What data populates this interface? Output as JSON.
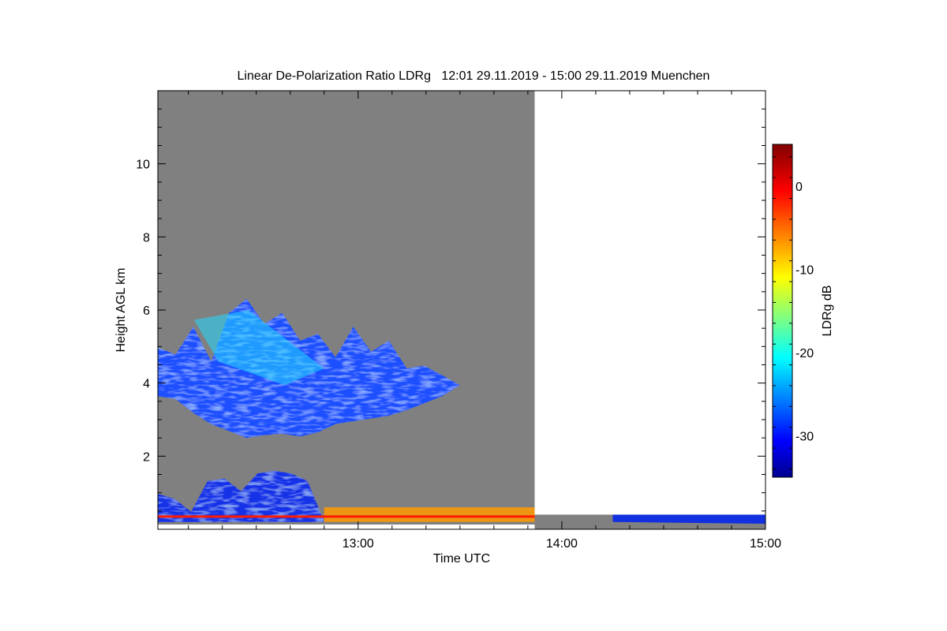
{
  "chart_data": {
    "type": "heatmap",
    "title": "Linear De-Polarization Ratio LDRg   12:01 29.11.2019 - 15:00 29.11.2019 Muenchen",
    "xlabel": "Time UTC",
    "ylabel": "Height AGL km",
    "x_range": [
      "12:01",
      "15:00"
    ],
    "x_ticks": [
      "13:00",
      "14:00",
      "15:00"
    ],
    "ylim": [
      0,
      12
    ],
    "y_ticks": [
      2,
      4,
      6,
      8,
      10
    ],
    "colorbar": {
      "label": "LDRg dB",
      "range": [
        -35,
        5
      ],
      "ticks": [
        0,
        -10,
        -20,
        -30
      ],
      "colormap": "jet"
    },
    "no_signal_color": "#808080",
    "no_data_color": "#ffffff",
    "data_gap": {
      "from": "13:52",
      "to": "15:00",
      "above_km": 0.4
    },
    "features": [
      {
        "name": "upper cloud layer",
        "t_start": "12:01",
        "t_end": "13:30",
        "z_bottom_km": 2.5,
        "z_top_km": 6.3,
        "ldr_db": [
          -32,
          -20
        ]
      },
      {
        "name": "low cloud",
        "t_start": "12:01",
        "t_end": "12:50",
        "z_bottom_km": 0.2,
        "z_top_km": 1.6,
        "ldr_db": [
          -33,
          -22
        ]
      },
      {
        "name": "near-surface layer",
        "t_start": "12:50",
        "t_end": "13:52",
        "z_bottom_km": 0.2,
        "z_top_km": 0.6,
        "ldr_db": [
          -10,
          0
        ]
      },
      {
        "name": "low layer after gap",
        "t_start": "14:15",
        "t_end": "15:00",
        "z_bottom_km": 0.15,
        "z_top_km": 0.4,
        "ldr_db": [
          -33,
          -28
        ]
      }
    ]
  }
}
